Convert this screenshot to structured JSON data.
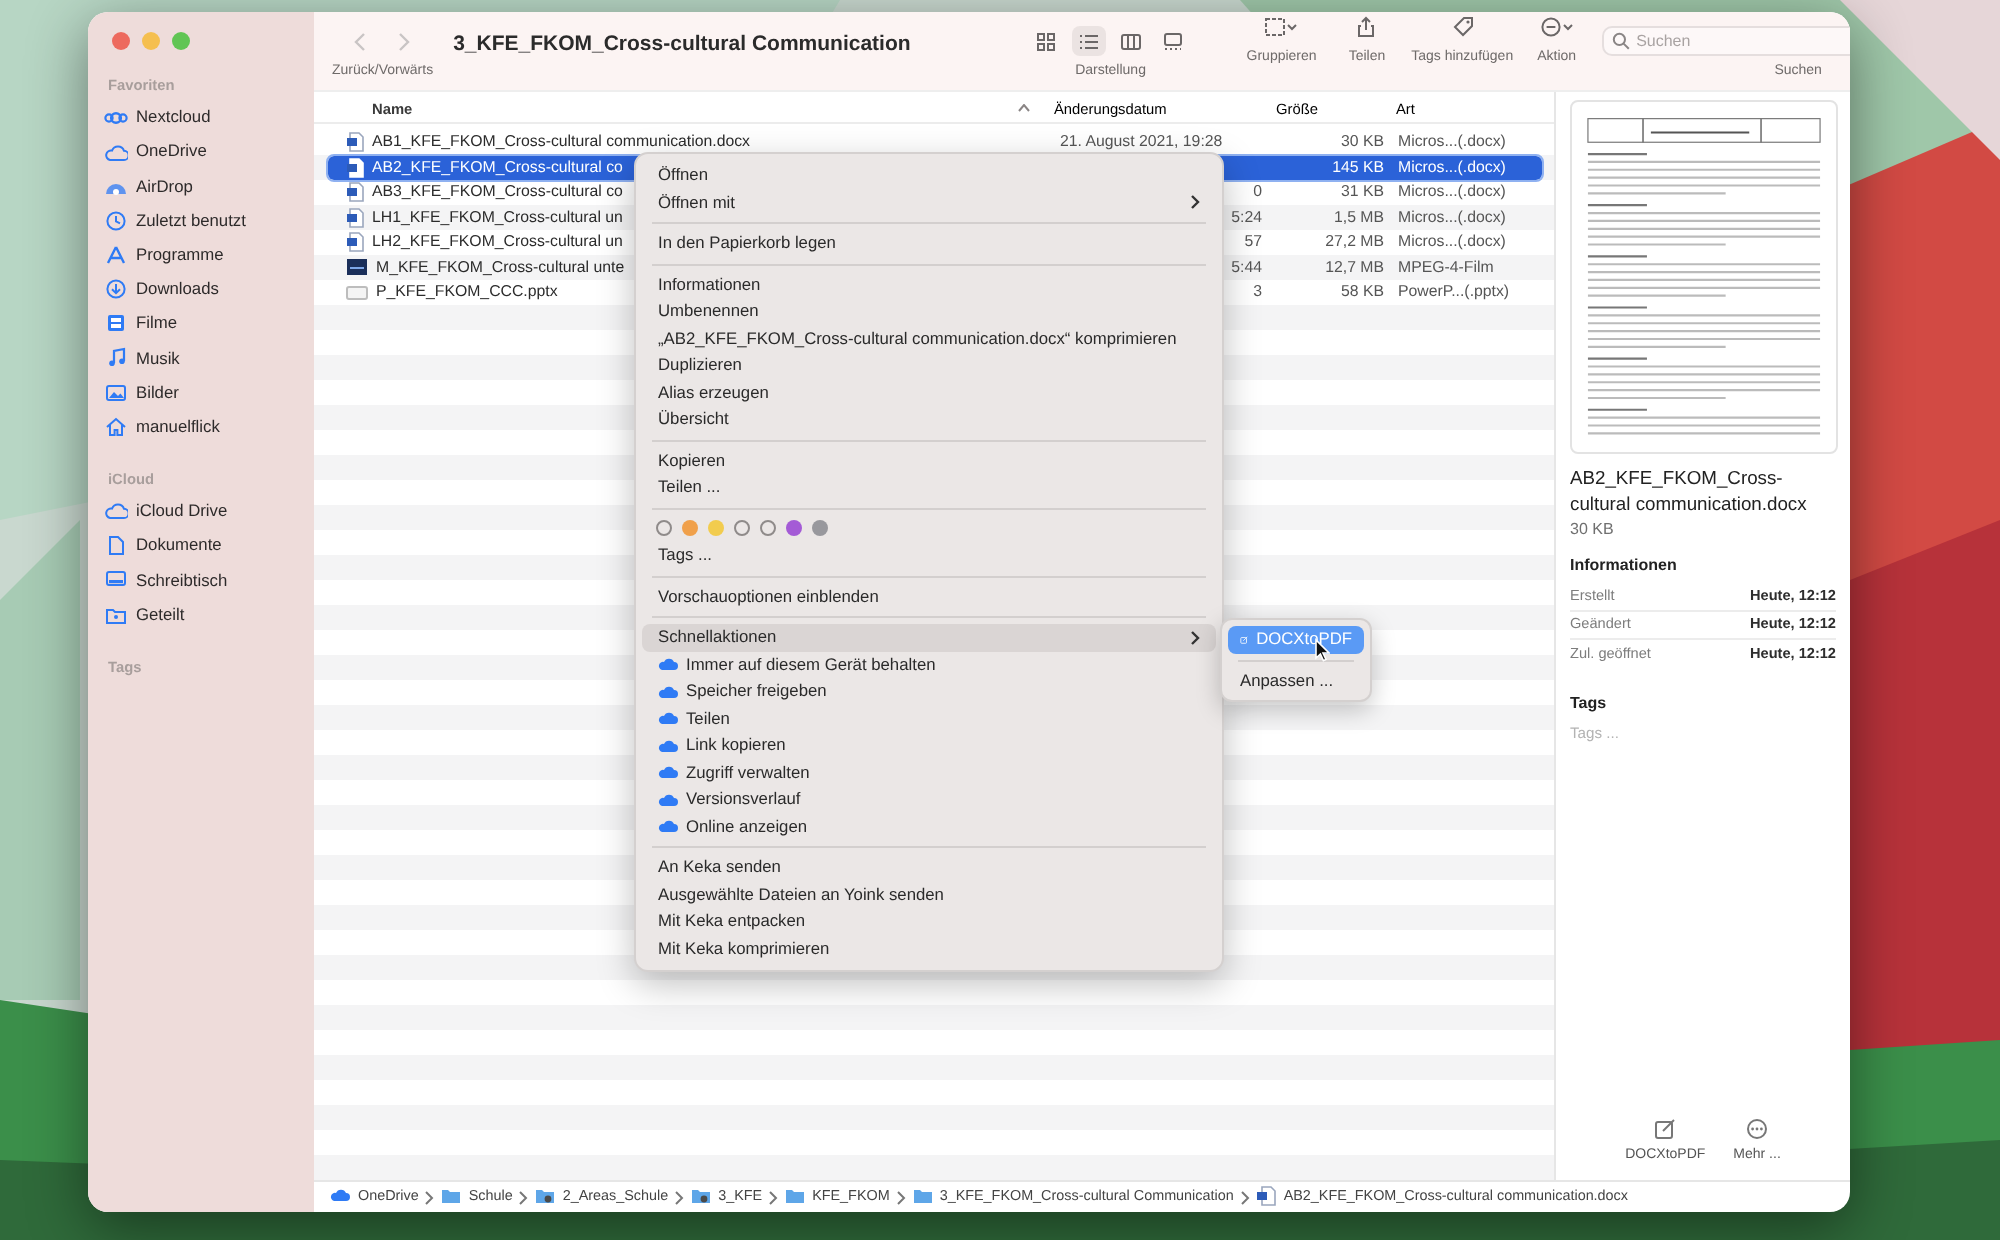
{
  "window": {
    "title": "3_KFE_FKOM_Cross-cultural Communication"
  },
  "toolbar": {
    "nav_label": "Zurück/Vorwärts",
    "back_disabled": true,
    "forward_disabled": true,
    "view_label": "Darstellung",
    "views": [
      {
        "kind": "icons",
        "selected": false
      },
      {
        "kind": "list",
        "selected": true
      },
      {
        "kind": "columns",
        "selected": false
      },
      {
        "kind": "gallery",
        "selected": false
      }
    ],
    "buttons": [
      {
        "kind": "group",
        "label": "Gruppieren"
      },
      {
        "kind": "share",
        "label": "Teilen"
      },
      {
        "kind": "tag",
        "label": "Tags hinzufügen"
      },
      {
        "kind": "action",
        "label": "Aktion"
      }
    ],
    "search": {
      "placeholder": "Suchen",
      "label": "Suchen"
    }
  },
  "sidebar": {
    "sections": [
      {
        "title": "Favoriten",
        "items": [
          {
            "label": "Nextcloud",
            "kind": "nextcloud"
          },
          {
            "label": "OneDrive",
            "kind": "cloud"
          },
          {
            "label": "AirDrop",
            "kind": "airdrop"
          },
          {
            "label": "Zuletzt benutzt",
            "kind": "recent"
          },
          {
            "label": "Programme",
            "kind": "apps"
          },
          {
            "label": "Downloads",
            "kind": "downloads"
          },
          {
            "label": "Filme",
            "kind": "movies"
          },
          {
            "label": "Musik",
            "kind": "music"
          },
          {
            "label": "Bilder",
            "kind": "pictures"
          },
          {
            "label": "manuelflick",
            "kind": "home"
          }
        ]
      },
      {
        "title": "iCloud",
        "items": [
          {
            "label": "iCloud Drive",
            "kind": "cloud"
          },
          {
            "label": "Dokumente",
            "kind": "documents"
          },
          {
            "label": "Schreibtisch",
            "kind": "desktop"
          },
          {
            "label": "Geteilt",
            "kind": "shared"
          }
        ]
      },
      {
        "title": "Tags"
      }
    ]
  },
  "table": {
    "columns": [
      {
        "label": "Name",
        "sorted": true
      },
      {
        "label": "Änderungsdatum",
        "sorted": false
      },
      {
        "label": "Größe",
        "sorted": false
      },
      {
        "label": "Art",
        "sorted": false
      }
    ],
    "rows": [
      {
        "kind": "docx",
        "name": "AB1_KFE_FKOM_Cross-cultural communication.docx",
        "date": "21. August 2021, 19:28",
        "date_partial": false,
        "size": "30 KB",
        "type": "Micros...(.docx)",
        "selected": false
      },
      {
        "kind": "docx",
        "name": "AB2_KFE_FKOM_Cross-cultural co",
        "size": "145 KB",
        "type": "Micros...(.docx)",
        "selected": true
      },
      {
        "kind": "docx",
        "name": "AB3_KFE_FKOM_Cross-cultural co",
        "date": "0",
        "date_partial": true,
        "size": "31 KB",
        "type": "Micros...(.docx)",
        "selected": false
      },
      {
        "kind": "docx",
        "name": "LH1_KFE_FKOM_Cross-cultural un",
        "date": "5:24",
        "date_partial": true,
        "size": "1,5 MB",
        "type": "Micros...(.docx)",
        "selected": false
      },
      {
        "kind": "docx",
        "name": "LH2_KFE_FKOM_Cross-cultural un",
        "date": "57",
        "date_partial": true,
        "size": "27,2 MB",
        "type": "Micros...(.docx)",
        "selected": false
      },
      {
        "kind": "video",
        "name": "M_KFE_FKOM_Cross-cultural unte",
        "date": "5:44",
        "date_partial": true,
        "size": "12,7 MB",
        "type": "MPEG-4-Film",
        "selected": false
      },
      {
        "kind": "pptx",
        "name": "P_KFE_FKOM_CCC.pptx",
        "date": "3",
        "date_partial": true,
        "size": "58 KB",
        "type": "PowerP...(.pptx)",
        "selected": false
      }
    ]
  },
  "context_menu": {
    "items": [
      {
        "kind": "item",
        "label": "Öffnen",
        "highlighted": false
      },
      {
        "kind": "submenu",
        "label": "Öffnen mit",
        "highlighted": false
      },
      {
        "kind": "separator"
      },
      {
        "kind": "item",
        "label": "In den Papierkorb legen",
        "highlighted": false
      },
      {
        "kind": "separator"
      },
      {
        "kind": "item",
        "label": "Informationen",
        "highlighted": false
      },
      {
        "kind": "item",
        "label": "Umbenennen",
        "highlighted": false
      },
      {
        "kind": "item",
        "label": "„AB2_KFE_FKOM_Cross-cultural communication.docx“ komprimieren",
        "highlighted": false
      },
      {
        "kind": "item",
        "label": "Duplizieren",
        "highlighted": false
      },
      {
        "kind": "item",
        "label": "Alias erzeugen",
        "highlighted": false
      },
      {
        "kind": "item",
        "label": "Übersicht",
        "highlighted": false
      },
      {
        "kind": "separator"
      },
      {
        "kind": "item",
        "label": "Kopieren",
        "highlighted": false
      },
      {
        "kind": "item",
        "label": "Teilen ...",
        "highlighted": false
      },
      {
        "kind": "separator"
      },
      {
        "kind": "tags",
        "dots": [
          {
            "filled": false
          },
          {
            "filled": true,
            "color": "#f0a04a"
          },
          {
            "filled": true,
            "color": "#f2cc4e"
          },
          {
            "filled": false
          },
          {
            "filled": false
          },
          {
            "filled": true,
            "color": "#a45bd6"
          },
          {
            "filled": true,
            "color": "#98989d"
          }
        ]
      },
      {
        "kind": "item",
        "label": "Tags ...",
        "highlighted": false
      },
      {
        "kind": "separator"
      },
      {
        "kind": "item",
        "label": "Vorschauoptionen einblenden",
        "highlighted": false
      },
      {
        "kind": "separator"
      },
      {
        "kind": "submenu",
        "label": "Schnellaktionen",
        "highlighted": true
      },
      {
        "kind": "cloud",
        "label": "Immer auf diesem Gerät behalten",
        "highlighted": false
      },
      {
        "kind": "cloud",
        "label": "Speicher freigeben",
        "highlighted": false
      },
      {
        "kind": "cloud",
        "label": "Teilen",
        "highlighted": false
      },
      {
        "kind": "cloud",
        "label": "Link kopieren",
        "highlighted": false
      },
      {
        "kind": "cloud",
        "label": "Zugriff verwalten",
        "highlighted": false
      },
      {
        "kind": "cloud",
        "label": "Versionsverlauf",
        "highlighted": false
      },
      {
        "kind": "cloud",
        "label": "Online anzeigen",
        "highlighted": false
      },
      {
        "kind": "separator"
      },
      {
        "kind": "item",
        "label": "An Keka senden",
        "highlighted": false
      },
      {
        "kind": "item",
        "label": "Ausgewählte Dateien an Yoink senden",
        "highlighted": false
      },
      {
        "kind": "item",
        "label": "Mit Keka entpacken",
        "highlighted": false
      },
      {
        "kind": "item",
        "label": "Mit Keka komprimieren",
        "highlighted": false
      }
    ]
  },
  "submenu": {
    "items": [
      {
        "kind": "action",
        "label": "DOCXtoPDF",
        "highlighted": true
      },
      {
        "kind": "separator"
      },
      {
        "kind": "item",
        "label": "Anpassen ...",
        "highlighted": false
      }
    ]
  },
  "preview": {
    "filename": "AB2_KFE_FKOM_Cross-cultural communication.docx",
    "size": "30 KB",
    "info_title": "Informationen",
    "info": [
      {
        "label": "Erstellt",
        "value": "Heute, 12:12"
      },
      {
        "label": "Geändert",
        "value": "Heute, 12:12"
      },
      {
        "label": "Zul. geöffnet",
        "value": "Heute, 12:12"
      }
    ],
    "tags_title": "Tags",
    "tags_placeholder": "Tags ...",
    "actions": [
      {
        "kind": "edit",
        "label": "DOCXtoPDF"
      },
      {
        "kind": "more",
        "label": "Mehr ..."
      }
    ]
  },
  "path": [
    {
      "kind": "cloud",
      "label": "OneDrive"
    },
    {
      "kind": "folder",
      "label": "Schule"
    },
    {
      "kind": "badge-folder",
      "label": "2_Areas_Schule"
    },
    {
      "kind": "badge-folder",
      "label": "3_KFE"
    },
    {
      "kind": "folder",
      "label": "KFE_FKOM"
    },
    {
      "kind": "folder",
      "label": "3_KFE_FKOM_Cross-cultural Communication"
    },
    {
      "kind": "docx",
      "label": "AB2_KFE_FKOM_Cross-cultural communication.docx"
    }
  ]
}
